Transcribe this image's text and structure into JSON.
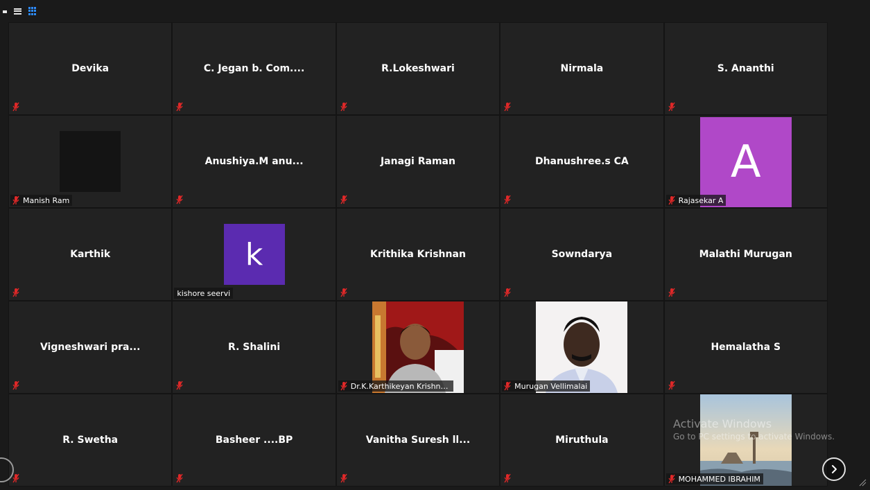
{
  "colors": {
    "tile_bg": "#222222",
    "muted_icon": "#e02828",
    "avatar_pink": "#b048c8",
    "avatar_purple": "#5b2bb0",
    "gallery_icon": "#2d8cff"
  },
  "toolbar": {
    "icons": [
      "minimize-icon",
      "speaker-view-icon",
      "gallery-view-icon"
    ]
  },
  "participants": [
    {
      "name": "Devika",
      "muted": true
    },
    {
      "name": "C. Jegan b. Com....",
      "muted": true
    },
    {
      "name": "R.Lokeshwari",
      "muted": true
    },
    {
      "name": "Nirmala",
      "muted": true
    },
    {
      "name": "S. Ananthi",
      "muted": true
    },
    {
      "name": "Manish Ram",
      "muted": true,
      "video": "black"
    },
    {
      "name": "Anushiya.M  anu...",
      "muted": true
    },
    {
      "name": "Janagi Raman",
      "muted": true
    },
    {
      "name": "Dhanushree.s CA",
      "muted": true
    },
    {
      "name": "Rajasekar A",
      "muted": true,
      "avatar_letter": "A"
    },
    {
      "name": "Karthik",
      "muted": true
    },
    {
      "name": "kishore seervi",
      "muted": false,
      "avatar_letter": "k"
    },
    {
      "name": "Krithika Krishnan",
      "muted": true
    },
    {
      "name": "Sowndarya",
      "muted": true
    },
    {
      "name": "Malathi Murugan",
      "muted": true
    },
    {
      "name": "Vigneshwari  pra...",
      "muted": true
    },
    {
      "name": "R. Shalini",
      "muted": true
    },
    {
      "name": "Dr.K.Karthikeyan Krishna...",
      "muted": true,
      "video": "photo"
    },
    {
      "name": "Murugan Vellimalai",
      "muted": true,
      "video": "photo"
    },
    {
      "name": "Hemalatha S",
      "muted": true
    },
    {
      "name": "R. Swetha",
      "muted": true
    },
    {
      "name": "Basheer ....BP",
      "muted": true
    },
    {
      "name": "Vanitha Suresh ll...",
      "muted": true
    },
    {
      "name": "Miruthula",
      "muted": true
    },
    {
      "name": "MOHAMMED IBRAHIM",
      "muted": true,
      "video": "photo"
    }
  ],
  "watermark": {
    "title": "Activate Windows",
    "subtitle": "Go to PC settings to activate Windows."
  },
  "navigation": {
    "next_icon": "chevron-right-icon",
    "prev_icon": "chevron-left-icon"
  }
}
